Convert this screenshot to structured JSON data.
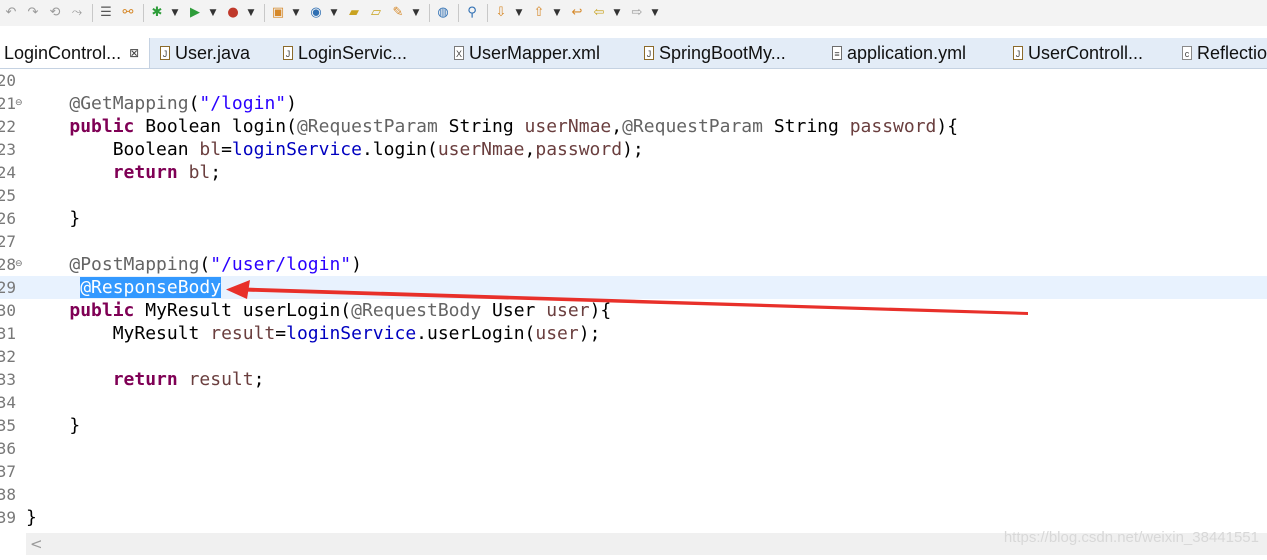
{
  "toolbar": {
    "icons": [
      "undo-icon",
      "redo-icon",
      "revert-icon",
      "forward-icon",
      "toggle-comment-icon",
      "link-icon",
      "debug-icon",
      "run-icon",
      "coverage-icon",
      "new-project-icon",
      "new-class-icon",
      "open-folder-icon",
      "open-type-icon",
      "pen-icon",
      "globe-icon",
      "search-icon",
      "next-annotation-icon",
      "prev-annotation-icon",
      "last-edit-icon",
      "back-icon",
      "forward-nav-icon"
    ]
  },
  "tabs": [
    {
      "label": "LoginControl...",
      "type": "java",
      "active": true
    },
    {
      "label": "User.java",
      "type": "java",
      "active": false
    },
    {
      "label": "LoginServic...",
      "type": "java",
      "active": false
    },
    {
      "label": "UserMapper.xml",
      "type": "xml",
      "active": false
    },
    {
      "label": "SpringBootMy...",
      "type": "java",
      "active": false
    },
    {
      "label": "application.yml",
      "type": "yml",
      "active": false
    },
    {
      "label": "UserControll...",
      "type": "java",
      "active": false
    },
    {
      "label": "Reflectio",
      "type": "class",
      "active": false
    }
  ],
  "tab_close_glyph": "⊠",
  "editor": {
    "lines": [
      {
        "num": "20",
        "fold": "",
        "tokens": []
      },
      {
        "num": "21",
        "fold": "⊖",
        "tokens": [
          {
            "t": "    ",
            "c": "plain"
          },
          {
            "t": "@GetMapping",
            "c": "ann"
          },
          {
            "t": "(",
            "c": "plain"
          },
          {
            "t": "\"/login\"",
            "c": "str"
          },
          {
            "t": ")",
            "c": "plain"
          }
        ]
      },
      {
        "num": "22",
        "fold": "",
        "tokens": [
          {
            "t": "    ",
            "c": "plain"
          },
          {
            "t": "public",
            "c": "kw"
          },
          {
            "t": " Boolean login(",
            "c": "plain"
          },
          {
            "t": "@RequestParam",
            "c": "ann"
          },
          {
            "t": " String ",
            "c": "plain"
          },
          {
            "t": "userNmae",
            "c": "param"
          },
          {
            "t": ",",
            "c": "plain"
          },
          {
            "t": "@RequestParam",
            "c": "ann"
          },
          {
            "t": " String ",
            "c": "plain"
          },
          {
            "t": "password",
            "c": "param"
          },
          {
            "t": "){",
            "c": "plain"
          }
        ]
      },
      {
        "num": "23",
        "fold": "",
        "tokens": [
          {
            "t": "        Boolean ",
            "c": "plain"
          },
          {
            "t": "bl",
            "c": "param"
          },
          {
            "t": "=",
            "c": "plain"
          },
          {
            "t": "loginService",
            "c": "field"
          },
          {
            "t": ".login(",
            "c": "plain"
          },
          {
            "t": "userNmae",
            "c": "param"
          },
          {
            "t": ",",
            "c": "plain"
          },
          {
            "t": "password",
            "c": "param"
          },
          {
            "t": ");",
            "c": "plain"
          }
        ]
      },
      {
        "num": "24",
        "fold": "",
        "tokens": [
          {
            "t": "        ",
            "c": "plain"
          },
          {
            "t": "return",
            "c": "kw"
          },
          {
            "t": " ",
            "c": "plain"
          },
          {
            "t": "bl",
            "c": "param"
          },
          {
            "t": ";",
            "c": "plain"
          }
        ]
      },
      {
        "num": "25",
        "fold": "",
        "tokens": []
      },
      {
        "num": "26",
        "fold": "",
        "tokens": [
          {
            "t": "    }",
            "c": "plain"
          }
        ]
      },
      {
        "num": "27",
        "fold": "",
        "tokens": []
      },
      {
        "num": "28",
        "fold": "⊖",
        "tokens": [
          {
            "t": "    ",
            "c": "plain"
          },
          {
            "t": "@PostMapping",
            "c": "ann"
          },
          {
            "t": "(",
            "c": "plain"
          },
          {
            "t": "\"/user/login\"",
            "c": "str"
          },
          {
            "t": ")",
            "c": "plain"
          }
        ]
      },
      {
        "num": "29",
        "fold": "",
        "current": true,
        "tokens": [
          {
            "t": "     ",
            "c": "plain"
          },
          {
            "t": "@ResponseBody",
            "c": "sel"
          }
        ]
      },
      {
        "num": "30",
        "fold": "",
        "tokens": [
          {
            "t": "    ",
            "c": "plain"
          },
          {
            "t": "public",
            "c": "kw"
          },
          {
            "t": " MyResult userLogin(",
            "c": "plain"
          },
          {
            "t": "@RequestBody",
            "c": "ann"
          },
          {
            "t": " User ",
            "c": "plain"
          },
          {
            "t": "user",
            "c": "param"
          },
          {
            "t": "){",
            "c": "plain"
          }
        ]
      },
      {
        "num": "31",
        "fold": "",
        "tokens": [
          {
            "t": "        MyResult ",
            "c": "plain"
          },
          {
            "t": "result",
            "c": "param"
          },
          {
            "t": "=",
            "c": "plain"
          },
          {
            "t": "loginService",
            "c": "field"
          },
          {
            "t": ".userLogin(",
            "c": "plain"
          },
          {
            "t": "user",
            "c": "param"
          },
          {
            "t": ");",
            "c": "plain"
          }
        ]
      },
      {
        "num": "32",
        "fold": "",
        "tokens": []
      },
      {
        "num": "33",
        "fold": "",
        "tokens": [
          {
            "t": "        ",
            "c": "plain"
          },
          {
            "t": "return",
            "c": "kw"
          },
          {
            "t": " ",
            "c": "plain"
          },
          {
            "t": "result",
            "c": "param"
          },
          {
            "t": ";",
            "c": "plain"
          }
        ]
      },
      {
        "num": "34",
        "fold": "",
        "tokens": []
      },
      {
        "num": "35",
        "fold": "",
        "tokens": [
          {
            "t": "    }",
            "c": "plain"
          }
        ]
      },
      {
        "num": "36",
        "fold": "",
        "tokens": []
      },
      {
        "num": "37",
        "fold": "",
        "tokens": []
      },
      {
        "num": "38",
        "fold": "",
        "tokens": []
      },
      {
        "num": "39",
        "fold": "",
        "tokens": [
          {
            "t": "}",
            "c": "plain"
          }
        ]
      }
    ]
  },
  "scrollbar": {
    "left_arrow": "<"
  },
  "watermark": "https://blog.csdn.net/weixin_38441551",
  "colors": {
    "keyword": "#7f0055",
    "annotation": "#646464",
    "string": "#2a00ff",
    "field": "#0000c0",
    "selection": "#3399ff",
    "current_line": "#e8f2fe",
    "arrow": "#e8302a"
  }
}
